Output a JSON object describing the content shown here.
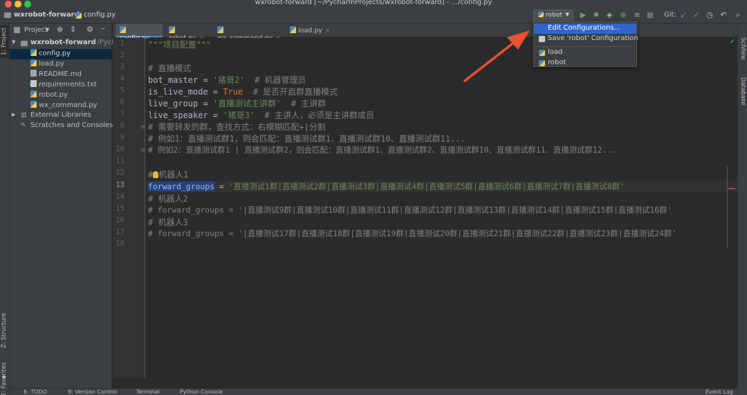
{
  "window": {
    "title": "wxrobot-forward [~/PycharmProjects/wxrobot-forward] - .../config.py"
  },
  "navbar": {
    "project": "wxrobot-forward",
    "file": "config.py",
    "run_config": "robot",
    "git_label": "Git:"
  },
  "tool_windows": {
    "left": [
      "1: Project",
      "Z: Structure",
      "2: Favorites"
    ],
    "right": [
      "SciView",
      "Database"
    ],
    "bottom": [
      "6: TODO",
      "9: Version Control",
      "Terminal",
      "Python Console",
      "Event Log"
    ]
  },
  "project_panel": {
    "dropdown": "Project",
    "root": "wxrobot-forward",
    "root_path": "~/Pych",
    "files": [
      "config.py",
      "load.py",
      "README.md",
      "requirements.txt",
      "robot.py",
      "wx_command.py"
    ],
    "external": "External Libraries",
    "scratches": "Scratches and Consoles"
  },
  "tabs": [
    {
      "label": "config.py",
      "active": true
    },
    {
      "label": "robot.py",
      "active": false
    },
    {
      "label": "wx_command.py",
      "active": false
    },
    {
      "label": "load.py",
      "active": false
    }
  ],
  "editor": {
    "line_numbers": [
      "1",
      "2",
      "3",
      "4",
      "5",
      "6",
      "7",
      "8",
      "9",
      "10",
      "11",
      "12",
      "13",
      "14",
      "15",
      "16",
      "17",
      "18"
    ],
    "current_line": "13",
    "lines": {
      "l1": "\"\"\"项目配置\"\"\"",
      "l3": "# 直播模式",
      "l4_code": "bot_master = ",
      "l4_str": "'猪哥2'",
      "l4_cm": "  # 机器管理员",
      "l5_code": "is_live_mode = ",
      "l5_kw": "True",
      "l5_cm": "  # 是否开启群直播模式",
      "l6_code": "live_group = ",
      "l6_str": "'直播测试主讲群'",
      "l6_cm": "  # 主讲群",
      "l7_code": "live_speaker = ",
      "l7_str": "'猪哥3'",
      "l7_cm": "  # 主讲人，必须是主讲群成员",
      "l8": "# 需要转发的群，查找方式：右模糊匹配+|分割",
      "l9": "# 例如1：直播测试群1，则会匹配：直播测试群1、直播测试群10、直播测试群11...",
      "l10": "# 例如2：直播测试群1 | 直播测试群2，则会匹配：直播测试群1、直播测试群2、直播测试群10、直播测试群11、直播测试群12...",
      "l12_hash": "#",
      "l12_rest": "机器人1",
      "l13_var": "forward_groups",
      "l13_eq": " = ",
      "l13_str": "'直播测试1群|直播测试2群|直播测试3群|直播测试4群|直播测试5群|直播测试6群|直播测试7群|直播测试8群'",
      "l14": "# 机器人2",
      "l15": "# forward_groups = '|直播测试9群|直播测试10群|直播测试11群|直播测试12群|直播测试13群|直播测试14群|直播测试15群|直播测试16群'",
      "l16": "# 机器人3",
      "l17": "# forward_groups = '|直播测试17群|直播测试18群|直播测试19群|直播测试20群|直播测试21群|直播测试22群|直播测试23群|直播测试24群'"
    }
  },
  "run_menu": {
    "edit": "Edit Configurations...",
    "save": "Save 'robot' Configuration",
    "configs": [
      "load",
      "robot"
    ]
  },
  "colors": {
    "accent": "#2f65ca",
    "arrow": "#e8522f"
  }
}
